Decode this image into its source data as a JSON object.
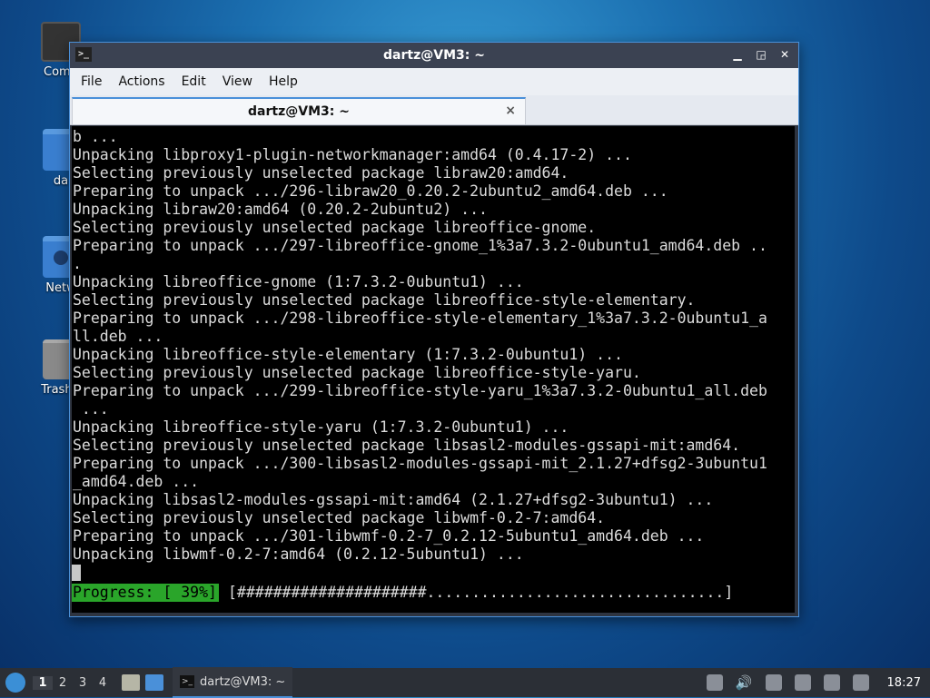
{
  "desktop": {
    "icons": [
      {
        "label": "Comp"
      },
      {
        "label": "da"
      },
      {
        "label": "Netw"
      },
      {
        "label": "Trash ("
      }
    ]
  },
  "window": {
    "title": "dartz@VM3: ~",
    "app_icon_glyph": ">_",
    "controls": {
      "minimize": "▁",
      "maximize": "◲",
      "close": "✕"
    },
    "menu": [
      "File",
      "Actions",
      "Edit",
      "View",
      "Help"
    ],
    "tab": {
      "label": "dartz@VM3: ~",
      "close": "×"
    }
  },
  "terminal": {
    "lines": [
      "b ...",
      "Unpacking libproxy1-plugin-networkmanager:amd64 (0.4.17-2) ...",
      "Selecting previously unselected package libraw20:amd64.",
      "Preparing to unpack .../296-libraw20_0.20.2-2ubuntu2_amd64.deb ...",
      "Unpacking libraw20:amd64 (0.20.2-2ubuntu2) ...",
      "Selecting previously unselected package libreoffice-gnome.",
      "Preparing to unpack .../297-libreoffice-gnome_1%3a7.3.2-0ubuntu1_amd64.deb ..",
      ".",
      "Unpacking libreoffice-gnome (1:7.3.2-0ubuntu1) ...",
      "Selecting previously unselected package libreoffice-style-elementary.",
      "Preparing to unpack .../298-libreoffice-style-elementary_1%3a7.3.2-0ubuntu1_a",
      "ll.deb ...",
      "Unpacking libreoffice-style-elementary (1:7.3.2-0ubuntu1) ...",
      "Selecting previously unselected package libreoffice-style-yaru.",
      "Preparing to unpack .../299-libreoffice-style-yaru_1%3a7.3.2-0ubuntu1_all.deb",
      " ...",
      "Unpacking libreoffice-style-yaru (1:7.3.2-0ubuntu1) ...",
      "Selecting previously unselected package libsasl2-modules-gssapi-mit:amd64.",
      "Preparing to unpack .../300-libsasl2-modules-gssapi-mit_2.1.27+dfsg2-3ubuntu1",
      "_amd64.deb ...",
      "Unpacking libsasl2-modules-gssapi-mit:amd64 (2.1.27+dfsg2-3ubuntu1) ...",
      "Selecting previously unselected package libwmf-0.2-7:amd64.",
      "Preparing to unpack .../301-libwmf-0.2-7_0.2.12-5ubuntu1_amd64.deb ...",
      "Unpacking libwmf-0.2-7:amd64 (0.2.12-5ubuntu1) ..."
    ],
    "progress_label": "Progress: [ 39%]",
    "progress_bar": "[#####################.................................]"
  },
  "taskbar": {
    "workspaces": [
      "1",
      "2",
      "3",
      "4"
    ],
    "active_workspace": "1",
    "task_title": "dartz@VM3: ~",
    "volume_glyph": "🔊",
    "clock": "18:27"
  }
}
